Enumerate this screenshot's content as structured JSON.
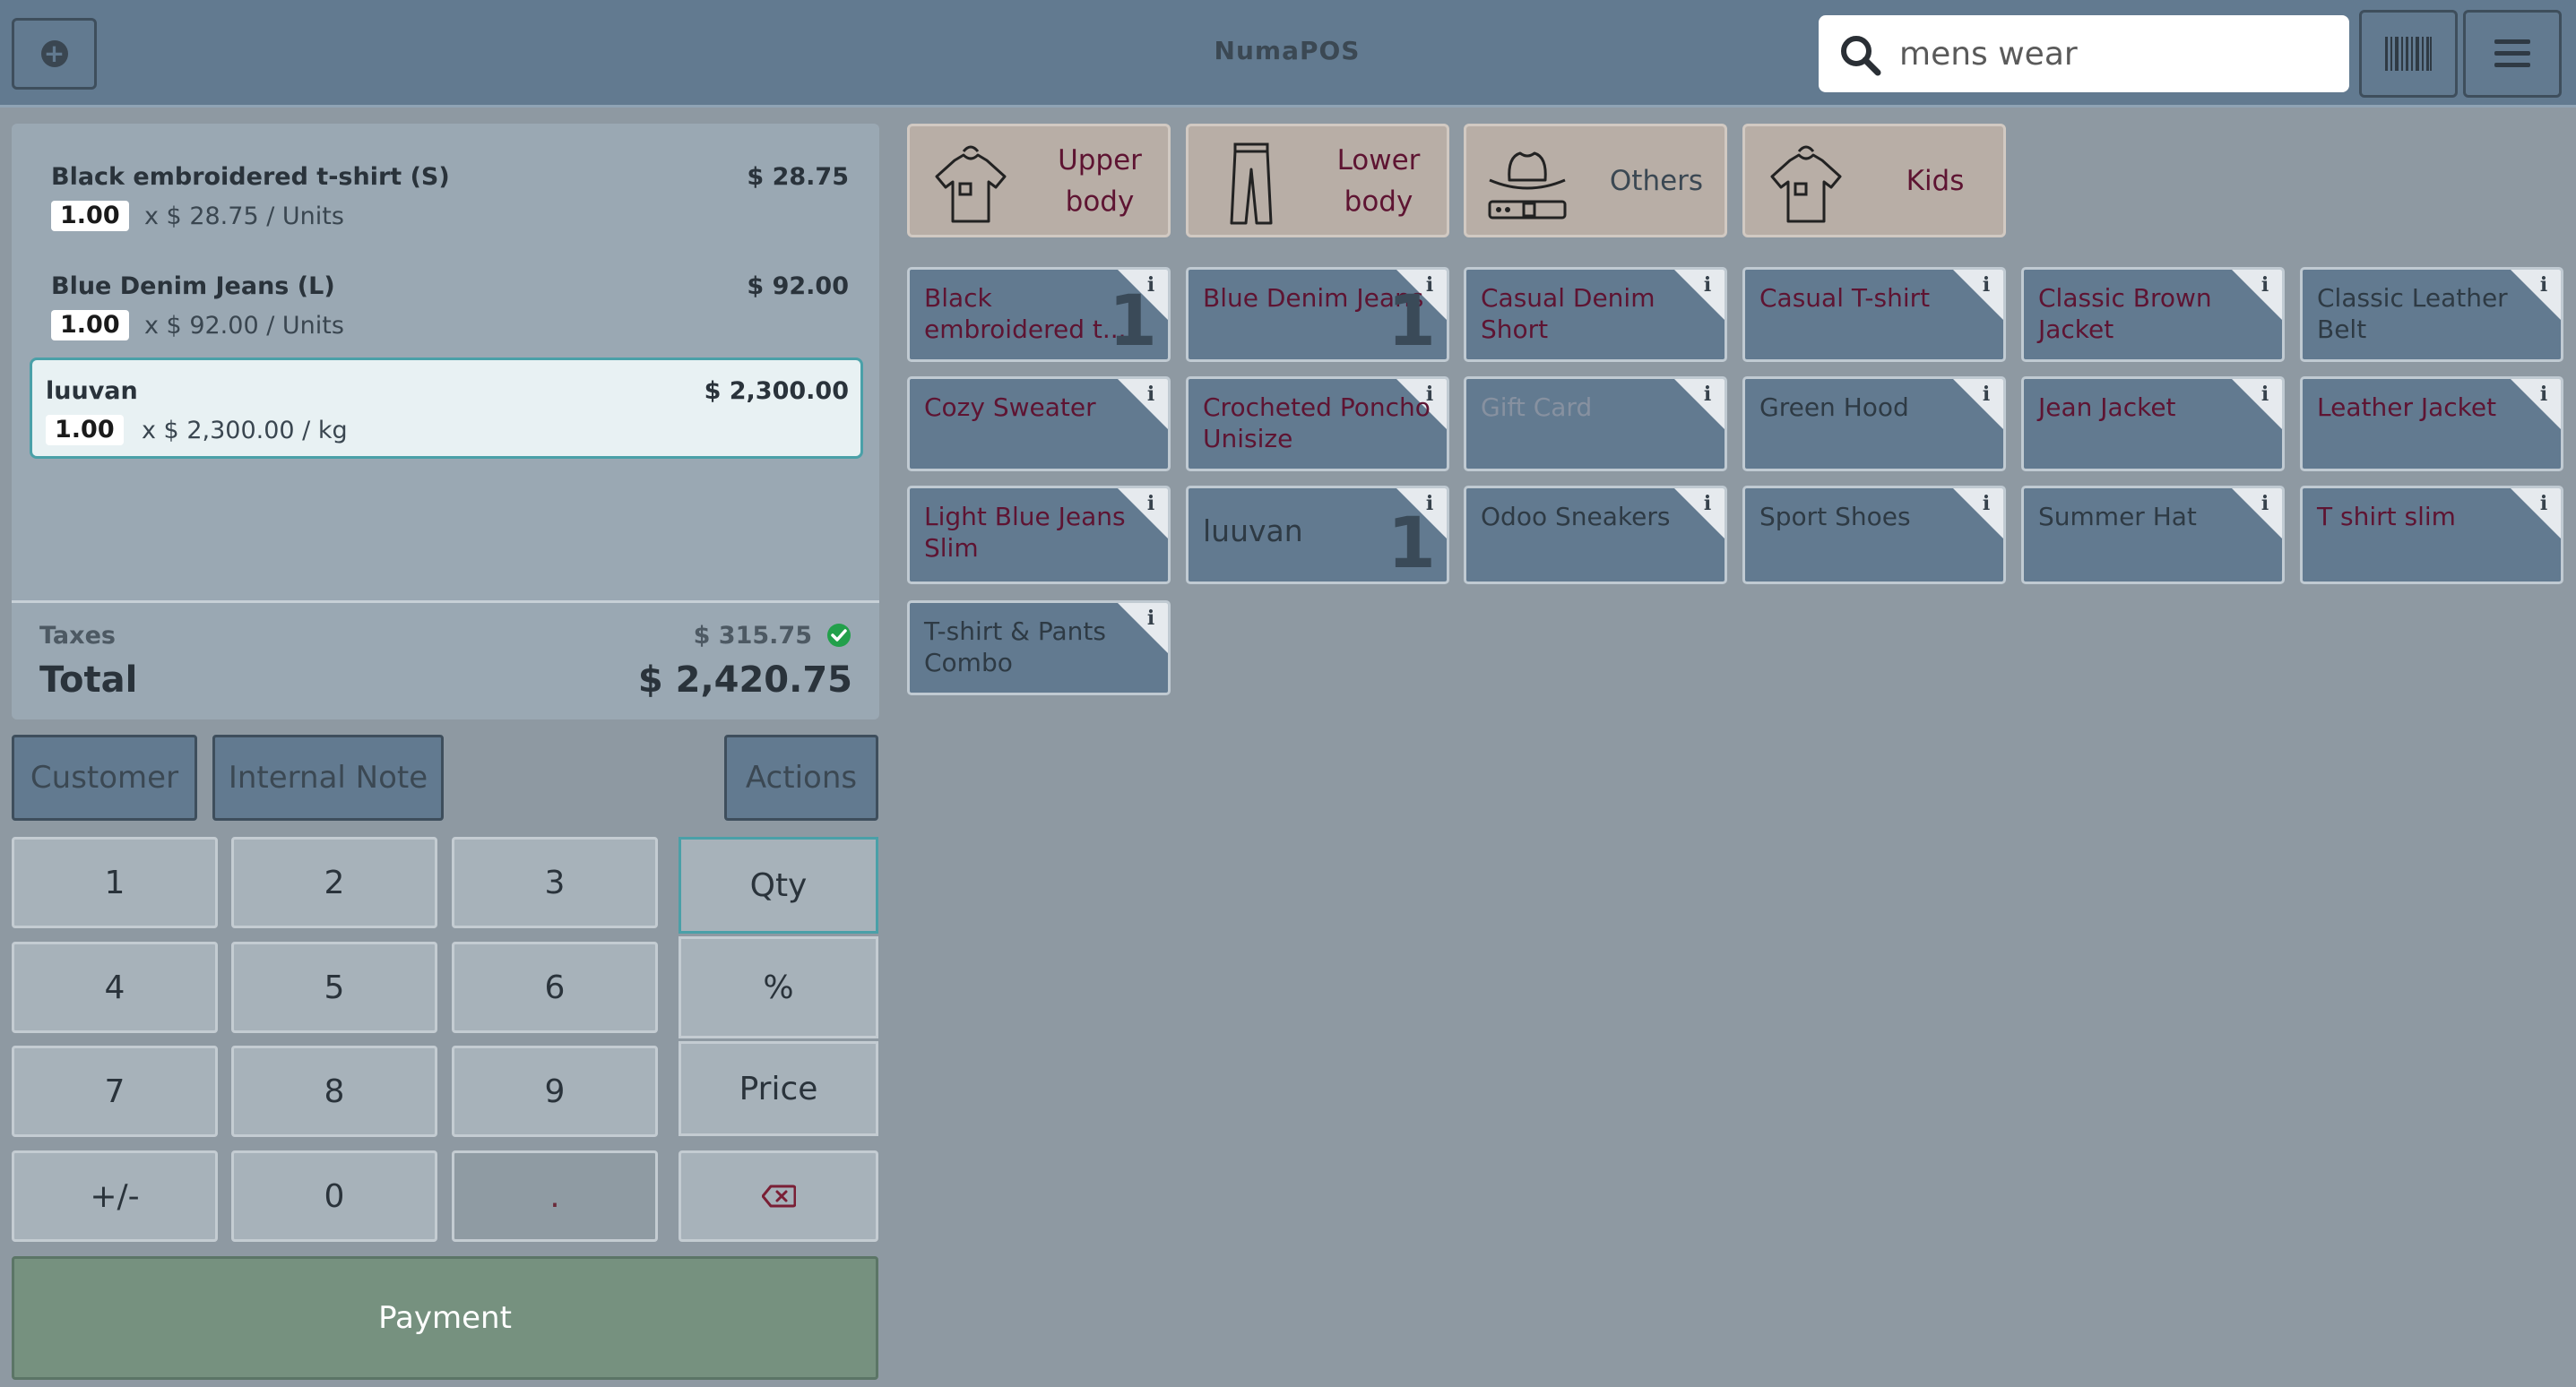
{
  "app": {
    "title": "NumaPOS"
  },
  "search": {
    "value": "mens wear",
    "icon": "search-icon"
  },
  "order": {
    "lines": [
      {
        "name": "Black embroidered t-shirt (S)",
        "price": "$ 28.75",
        "qty": "1.00",
        "unit_text": "x $ 28.75 / Units"
      },
      {
        "name": "Blue Denim Jeans (L)",
        "price": "$ 92.00",
        "qty": "1.00",
        "unit_text": "x $ 92.00 / Units"
      },
      {
        "name": "luuvan",
        "price": "$ 2,300.00",
        "qty": "1.00",
        "unit_text": "x $ 2,300.00 / kg"
      }
    ],
    "taxes_label": "Taxes",
    "taxes_value": "$ 315.75",
    "total_label": "Total",
    "total_value": "$ 2,420.75"
  },
  "controls": {
    "customer": "Customer",
    "internal_note": "Internal Note",
    "actions": "Actions"
  },
  "numpad": {
    "keys": [
      "1",
      "2",
      "3",
      "4",
      "5",
      "6",
      "7",
      "8",
      "9",
      "+/-",
      "0",
      "."
    ],
    "modes": {
      "qty": "Qty",
      "percent": "%",
      "price": "Price"
    },
    "payment": "Payment"
  },
  "categories": [
    {
      "label": "Upper body",
      "icon": "tshirt-icon"
    },
    {
      "label": "Lower body",
      "icon": "pants-icon"
    },
    {
      "label": "Others",
      "icon": "hat-belt-icon"
    },
    {
      "label": "Kids",
      "icon": "tshirt-icon"
    }
  ],
  "products": [
    {
      "name": "Black embroidered t...",
      "qty": "1"
    },
    {
      "name": "Blue Denim Jeans",
      "qty": "1"
    },
    {
      "name": "Casual Denim Short"
    },
    {
      "name": "Casual T-shirt"
    },
    {
      "name": "Classic Brown Jacket"
    },
    {
      "name": "Classic Leather Belt"
    },
    {
      "name": "Cozy Sweater"
    },
    {
      "name": "Crocheted Poncho Unisize"
    },
    {
      "name": "Gift Card"
    },
    {
      "name": "Green Hood"
    },
    {
      "name": "Jean Jacket"
    },
    {
      "name": "Leather Jacket"
    },
    {
      "name": "Light Blue Jeans Slim"
    },
    {
      "name": "luuvan",
      "qty": "1"
    },
    {
      "name": "Odoo Sneakers"
    },
    {
      "name": "Sport Shoes"
    },
    {
      "name": "Summer Hat"
    },
    {
      "name": "T shirt slim"
    },
    {
      "name": "T-shirt & Pants Combo"
    }
  ],
  "colors": {
    "topbar": "#627a90",
    "background": "#8e99a2",
    "category_bg": "#b8aea6",
    "product_bg": "#627a90",
    "accent": "#4aa0a8",
    "payment": "#76917f",
    "product_text": "#5e1432"
  }
}
